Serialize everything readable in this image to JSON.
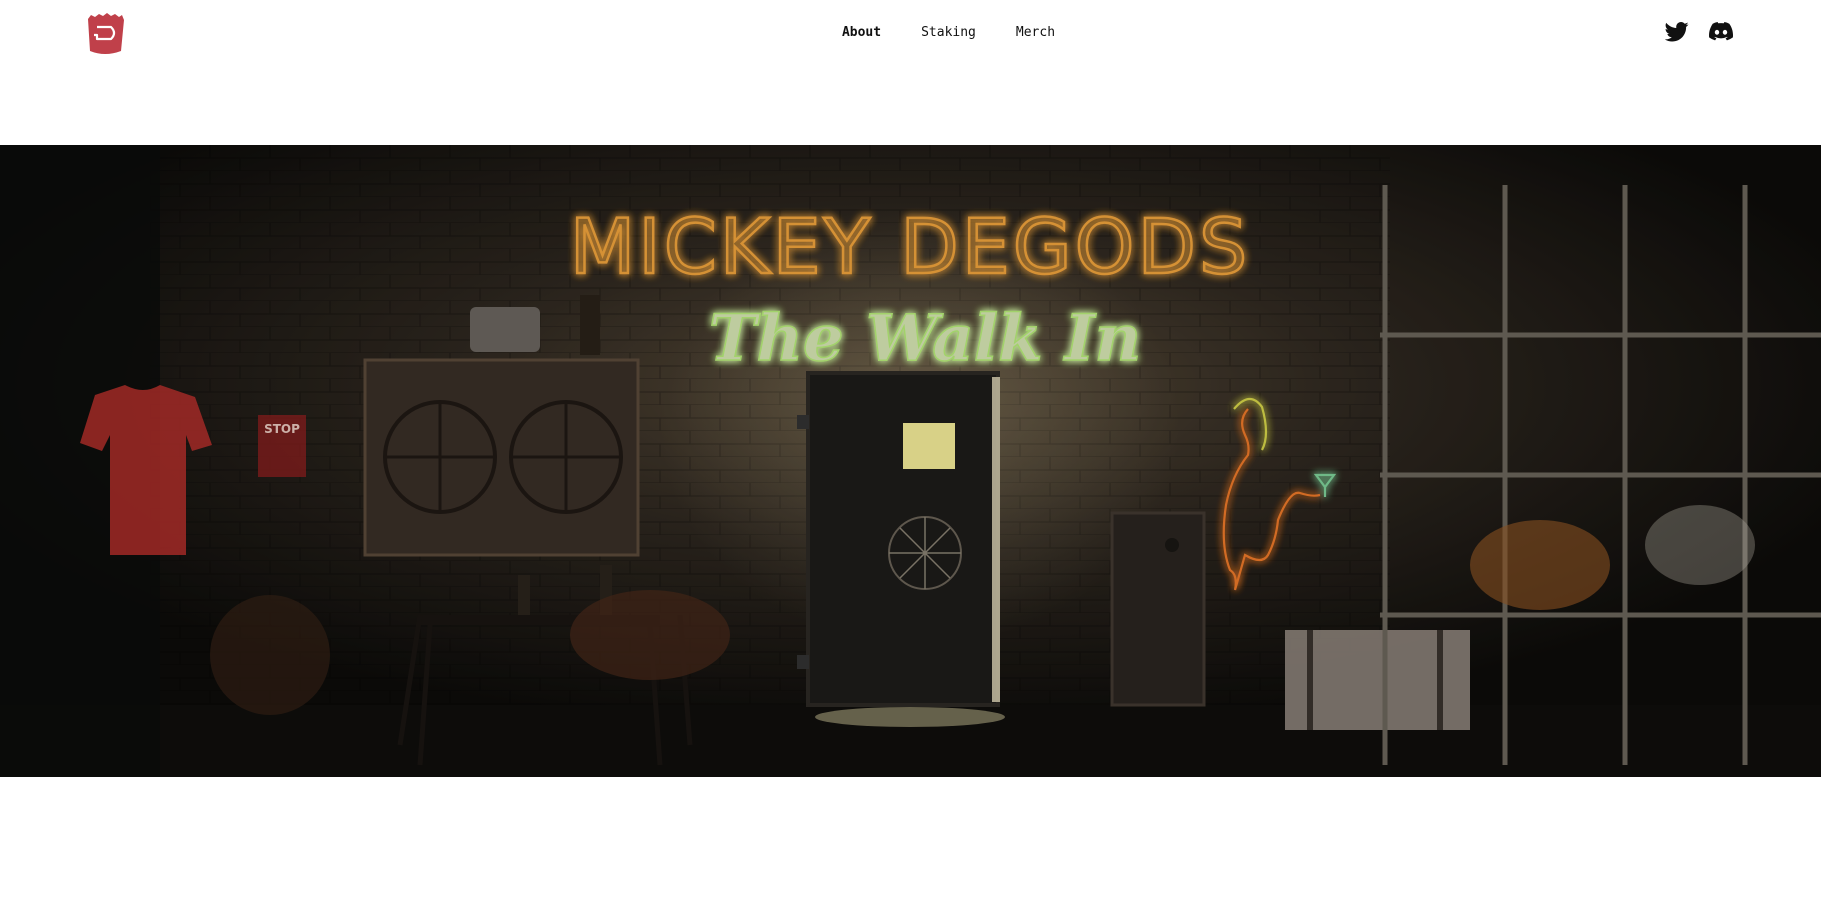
{
  "brand": {
    "logo_icon": "fries-logo-icon",
    "color": "#c0404a"
  },
  "nav": {
    "items": [
      {
        "label": "About",
        "active": true
      },
      {
        "label": "Staking",
        "active": false
      },
      {
        "label": "Merch",
        "active": false
      }
    ]
  },
  "social": {
    "icons": [
      "twitter-icon",
      "discord-icon"
    ]
  },
  "hero": {
    "neon_title": "MICKEY DEGODS",
    "neon_subtitle": "The Walk In",
    "sign_text": "STOP",
    "colors": {
      "neon_orange": "#f3a53c",
      "neon_green": "#b9f07a",
      "neon_figure": "#f07a2a",
      "window_glow": "#f6ee9a",
      "shirt": "#b8302c"
    }
  }
}
